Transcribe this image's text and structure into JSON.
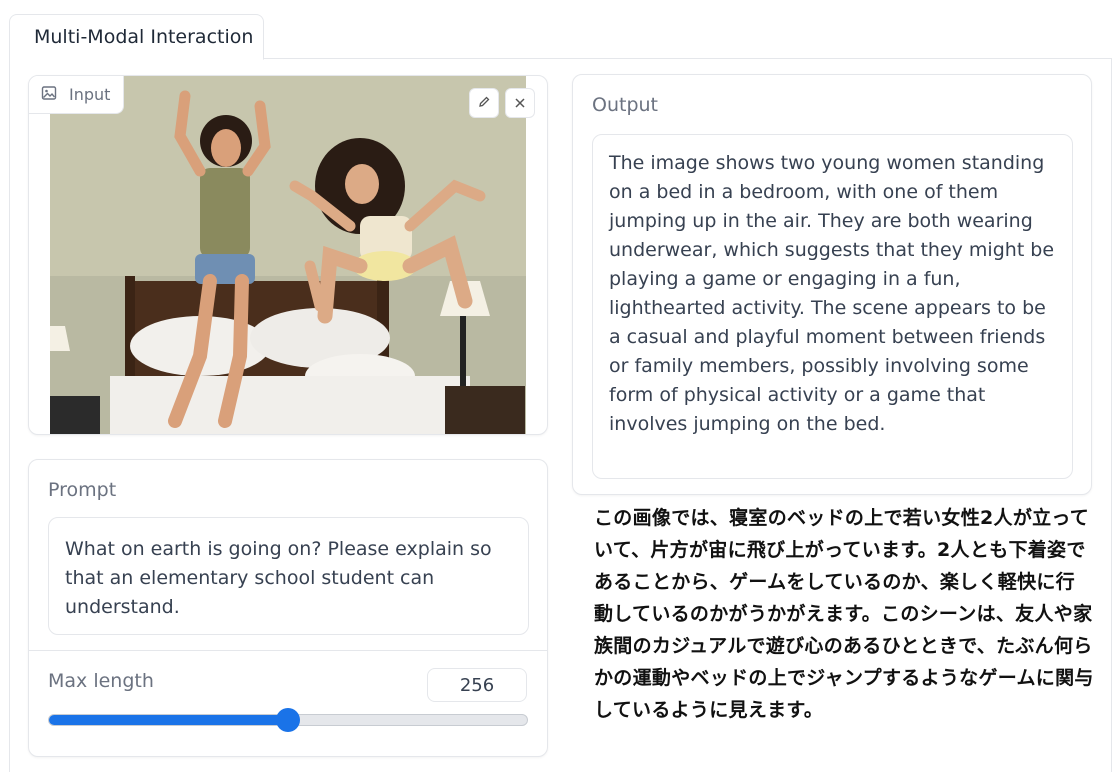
{
  "tabs": [
    {
      "label": "Multi-Modal Interaction",
      "active": true
    }
  ],
  "image_input": {
    "label": "Input",
    "icon": "image-icon",
    "tools": [
      "edit-icon",
      "close-icon"
    ]
  },
  "prompt": {
    "label": "Prompt",
    "value": "What on earth is going on? Please explain so that an elementary school student can understand."
  },
  "max_length": {
    "label": "Max length",
    "value": "256",
    "slider_fraction": 0.5
  },
  "output": {
    "label": "Output",
    "text": "The image shows two young women standing on a bed in a bedroom, with one of them jumping up in the air. They are both wearing underwear, which suggests that they might be playing a game or engaging in a fun, lighthearted activity. The scene appears to be a casual and playful moment between friends or family members, possibly involving some form of physical activity or a game that involves jumping on the bed."
  },
  "translation": {
    "text": "この画像では、寝室のベッドの上で若い女性2人が立っていて、片方が宙に飛び上がっています。2人とも下着姿であることから、ゲームをしているのか、楽しく軽快に行動しているのかがうかがえます。このシーンは、友人や家族間のカジュアルで遊び心のあるひとときで、たぶん何らかの運動やベッドの上でジャンプするようなゲームに関与しているように見えます。"
  },
  "colors": {
    "accent": "#1a73e8",
    "border": "#e5e7eb",
    "label": "#6b7280"
  }
}
